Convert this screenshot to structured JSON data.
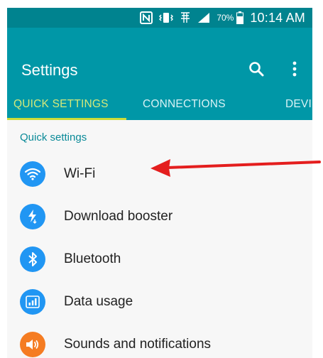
{
  "status_bar": {
    "battery_percent": "70%",
    "time": "10:14 AM",
    "icons": [
      "nfc-icon",
      "vibrate-icon",
      "hd-voice-icon",
      "signal-icon",
      "battery-icon"
    ]
  },
  "app_bar": {
    "title": "Settings",
    "icons": [
      "search-icon",
      "more-vert-icon"
    ]
  },
  "tabs": [
    {
      "label": "QUICK SETTINGS",
      "active": true
    },
    {
      "label": "CONNECTIONS",
      "active": false
    },
    {
      "label": "DEVI",
      "active": false
    }
  ],
  "section_header": "Quick settings",
  "items": [
    {
      "label": "Wi-Fi",
      "icon": "wifi-icon",
      "color": "#2196f3"
    },
    {
      "label": "Download booster",
      "icon": "download-booster-icon",
      "color": "#2196f3"
    },
    {
      "label": "Bluetooth",
      "icon": "bluetooth-icon",
      "color": "#2196f3"
    },
    {
      "label": "Data usage",
      "icon": "data-usage-icon",
      "color": "#2196f3"
    },
    {
      "label": "Sounds and notifications",
      "icon": "volume-icon",
      "color": "#f57c22"
    }
  ],
  "colors": {
    "status_bar": "#00838f",
    "app_bar": "#0097a7",
    "tab_active": "#d4e97a",
    "tab_indicator": "#cddc39",
    "arrow": "#e41e1e"
  }
}
